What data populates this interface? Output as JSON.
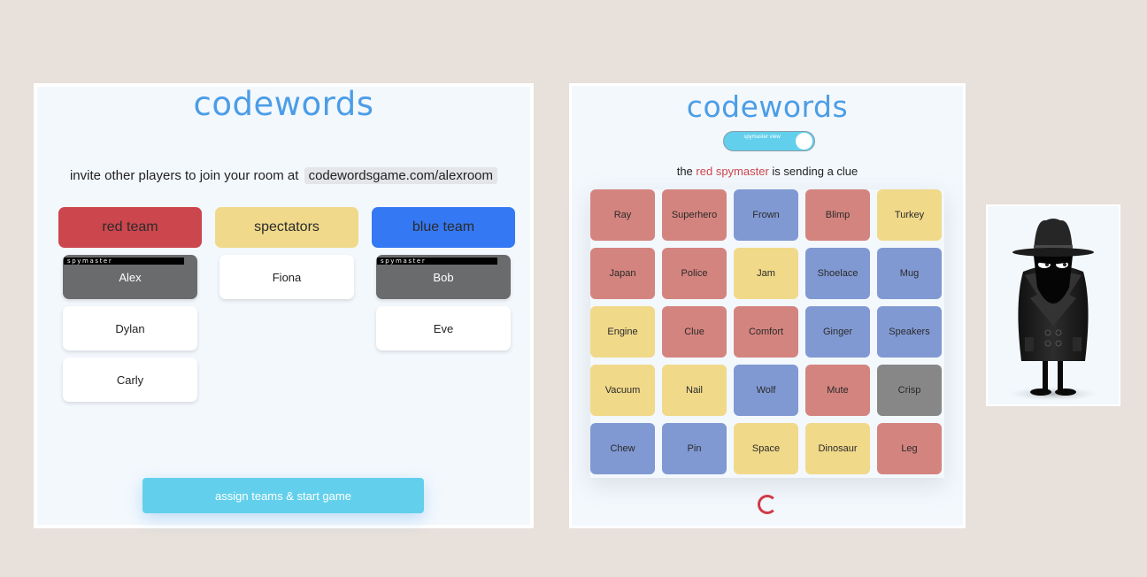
{
  "lobby": {
    "logo": "codewords",
    "invite_text": "invite other players to join your room at",
    "room_url": "codewordsgame.com/alexroom",
    "teams": [
      {
        "label": "red team",
        "color": "#cc464d"
      },
      {
        "label": "spectators",
        "color": "#f0d98a"
      },
      {
        "label": "blue team",
        "color": "#3578f3"
      }
    ],
    "spymaster_tag": "spymaster",
    "red_players": [
      "Alex",
      "Dylan",
      "Carly"
    ],
    "spectators": [
      "Fiona"
    ],
    "blue_players": [
      "Bob",
      "Eve"
    ],
    "start_button": "assign teams & start game"
  },
  "game": {
    "logo": "codewords",
    "toggle_label": "spymaster view",
    "toggle_on": true,
    "status_prefix": "the",
    "status_team": "red spymaster",
    "status_suffix": "is sending a clue",
    "cards": [
      {
        "word": "Ray",
        "team": "red"
      },
      {
        "word": "Superhero",
        "team": "red"
      },
      {
        "word": "Frown",
        "team": "blue"
      },
      {
        "word": "Blimp",
        "team": "red"
      },
      {
        "word": "Turkey",
        "team": "neutral"
      },
      {
        "word": "Japan",
        "team": "red"
      },
      {
        "word": "Police",
        "team": "red"
      },
      {
        "word": "Jam",
        "team": "neutral"
      },
      {
        "word": "Shoelace",
        "team": "blue"
      },
      {
        "word": "Mug",
        "team": "blue"
      },
      {
        "word": "Engine",
        "team": "neutral"
      },
      {
        "word": "Clue",
        "team": "red"
      },
      {
        "word": "Comfort",
        "team": "red"
      },
      {
        "word": "Ginger",
        "team": "blue"
      },
      {
        "word": "Speakers",
        "team": "blue"
      },
      {
        "word": "Vacuum",
        "team": "neutral"
      },
      {
        "word": "Nail",
        "team": "neutral"
      },
      {
        "word": "Wolf",
        "team": "blue"
      },
      {
        "word": "Mute",
        "team": "red"
      },
      {
        "word": "Crisp",
        "team": "assassin"
      },
      {
        "word": "Chew",
        "team": "blue"
      },
      {
        "word": "Pin",
        "team": "blue"
      },
      {
        "word": "Space",
        "team": "neutral"
      },
      {
        "word": "Dinosaur",
        "team": "neutral"
      },
      {
        "word": "Leg",
        "team": "red"
      }
    ],
    "loader_icon": "loading-spinner-icon"
  },
  "spy_image": {
    "icon": "spy-character-illustration"
  }
}
